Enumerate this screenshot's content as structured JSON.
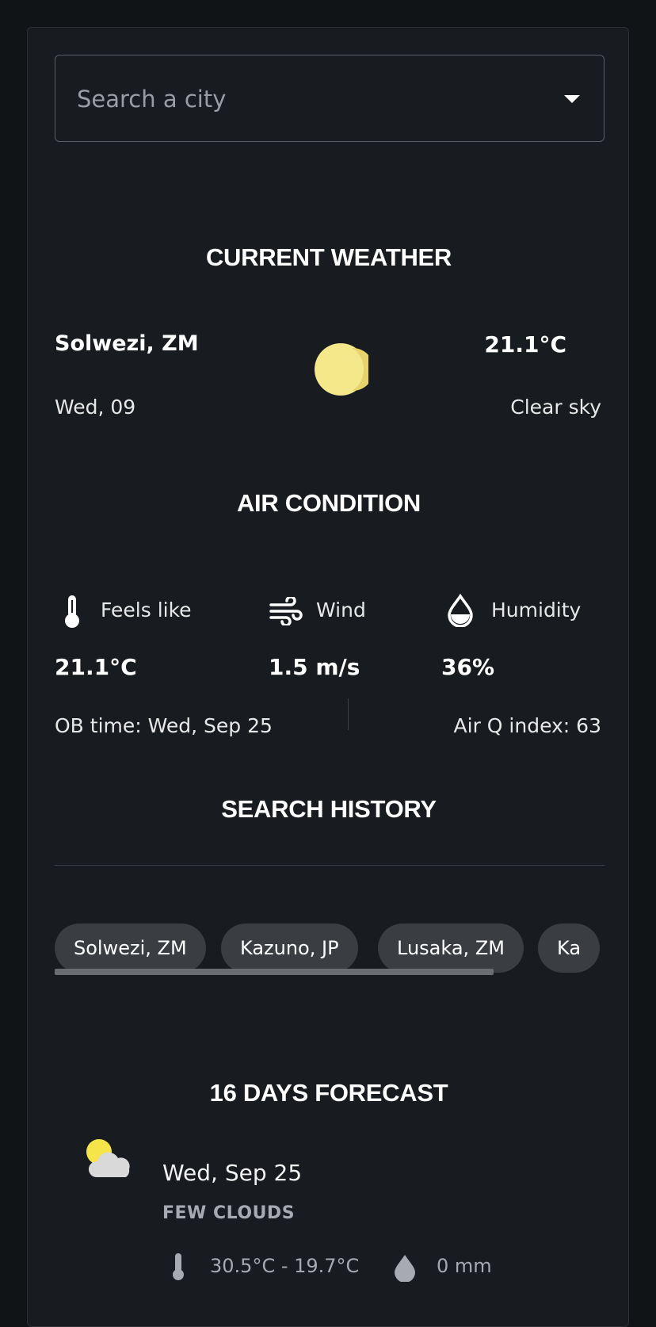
{
  "search": {
    "placeholder": "Search a city"
  },
  "current": {
    "title": "CURRENT WEATHER",
    "city": "Solwezi, ZM",
    "date": "Wed, 09",
    "temperature": "21.1°C",
    "description": "Clear sky",
    "icon": "moon-icon"
  },
  "air": {
    "title": "AIR CONDITION",
    "feels_like_label": "Feels like",
    "feels_like_value": "21.1°C",
    "wind_label": "Wind",
    "wind_value": "1.5 m/s",
    "humidity_label": "Humidity",
    "humidity_value": "36%",
    "ob_time": "OB time: Wed, Sep 25",
    "air_quality": "Air Q index: 63"
  },
  "history": {
    "title": "SEARCH HISTORY",
    "items": [
      "Solwezi, ZM",
      "Kazuno, JP",
      "Lusaka, ZM",
      "Ka"
    ]
  },
  "forecast": {
    "title": "16 DAYS FORECAST",
    "days": [
      {
        "date": "Wed, Sep 25",
        "description": "FEW CLOUDS",
        "temp_range": "30.5°C - 19.7°C",
        "rain": "0 mm",
        "icon": "few-clouds-icon"
      }
    ]
  },
  "colors": {
    "background": "#111416",
    "card": "#181b1f",
    "chip": "#3a3d42",
    "muted_text": "#a7abb1",
    "sun": "#f5e88a"
  }
}
